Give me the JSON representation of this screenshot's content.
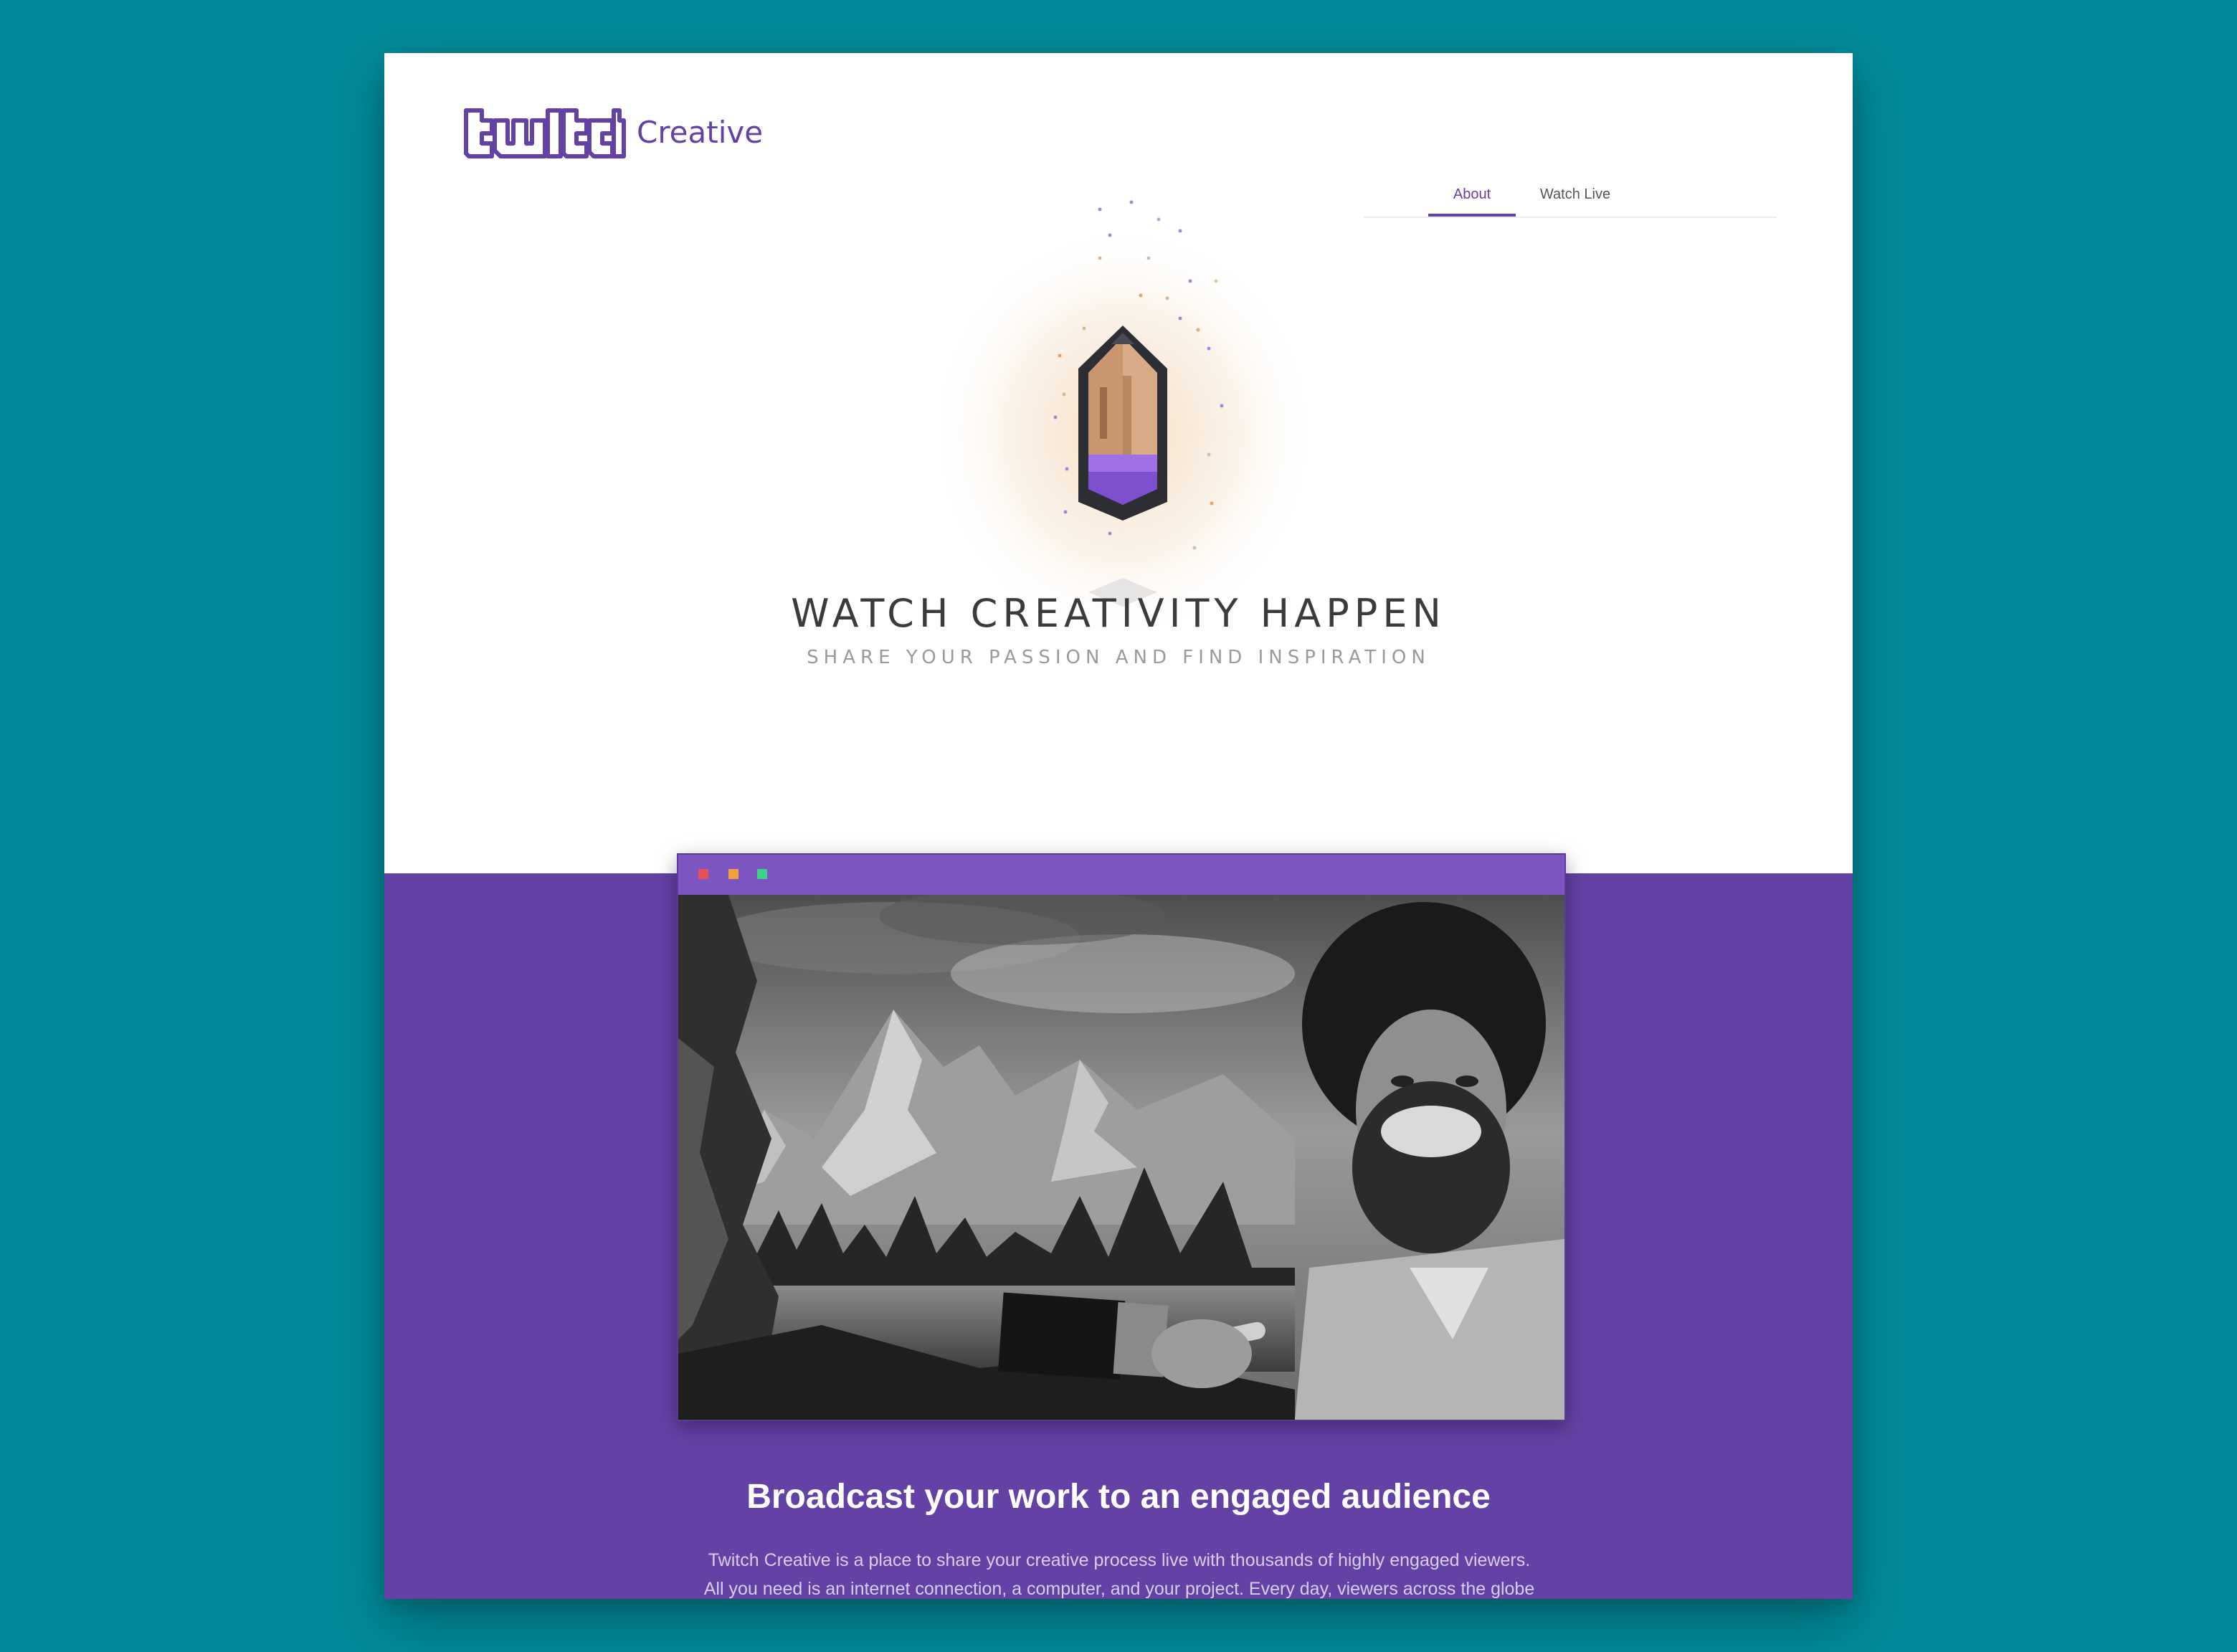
{
  "header": {
    "logo_text": "twitch",
    "logo_sub": "Creative",
    "nav": [
      {
        "label": "About",
        "active": true
      },
      {
        "label": "Watch Live",
        "active": false
      }
    ]
  },
  "hero": {
    "icon": "pencil-icon",
    "title": "WATCH CREATIVITY HAPPEN",
    "subtitle": "SHARE YOUR PASSION AND FIND INSPIRATION"
  },
  "feature": {
    "window_dots": [
      "#e8505b",
      "#f0a040",
      "#3fd08a"
    ],
    "image": "painter-with-landscape-painting",
    "title": "Broadcast your work to an engaged audience",
    "body_line1": "Twitch Creative is a place to share your creative process live with thousands of highly engaged viewers.",
    "body_line2": "All you need is an internet connection, a computer, and your project.  Every day, viewers across the globe"
  },
  "colors": {
    "brand": "#6441a5",
    "background": "#008a99",
    "browser_bar": "#7d55c0"
  }
}
